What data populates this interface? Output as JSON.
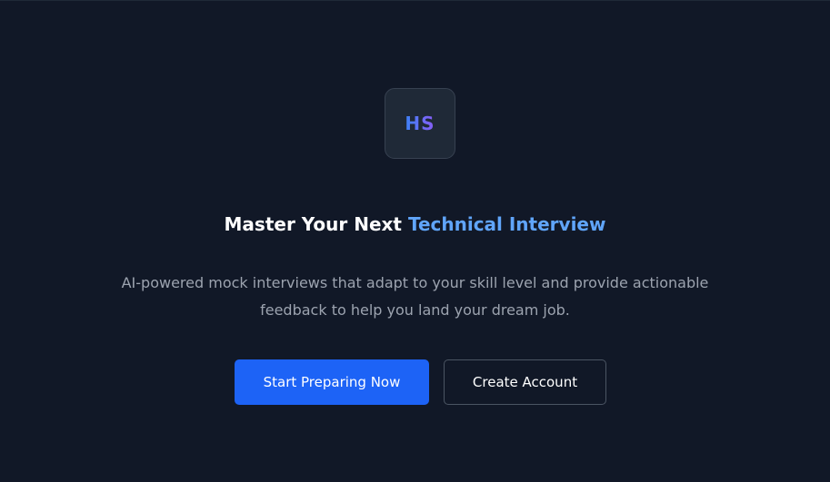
{
  "logo": {
    "initials": "HS"
  },
  "hero": {
    "title_part1": "Master Your Next ",
    "title_highlight": "Technical Interview",
    "subtitle": "AI-powered mock interviews that adapt to your skill level and provide actionable feedback to help you land your dream job."
  },
  "actions": {
    "primary_label": "Start Preparing Now",
    "secondary_label": "Create Account"
  },
  "colors": {
    "background": "#111827",
    "accent": "#60a5fa",
    "primary_button": "#1d63f6",
    "subtitle_text": "#9ca3af"
  }
}
